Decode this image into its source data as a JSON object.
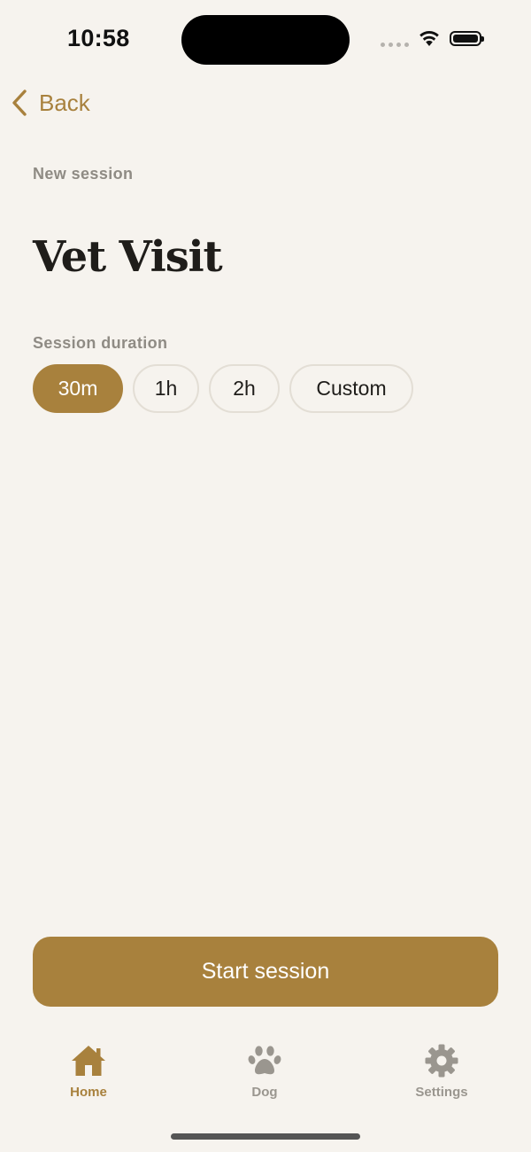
{
  "status_bar": {
    "time": "10:58"
  },
  "nav": {
    "back_label": "Back"
  },
  "eyebrow": "New session",
  "title": "Vet Visit",
  "duration": {
    "label": "Session duration",
    "options": [
      "30m",
      "1h",
      "2h",
      "Custom"
    ],
    "selected": "30m"
  },
  "start_button_label": "Start session",
  "tabs": [
    {
      "label": "Home",
      "icon": "home-icon",
      "active": true
    },
    {
      "label": "Dog",
      "icon": "paw-icon",
      "active": false
    },
    {
      "label": "Settings",
      "icon": "gear-icon",
      "active": false
    }
  ],
  "colors": {
    "accent": "#a8813d",
    "background": "#f6f3ee",
    "muted_text": "#8f8b84",
    "inactive_tab": "#9a968f",
    "chip_border": "#e3ded5"
  }
}
